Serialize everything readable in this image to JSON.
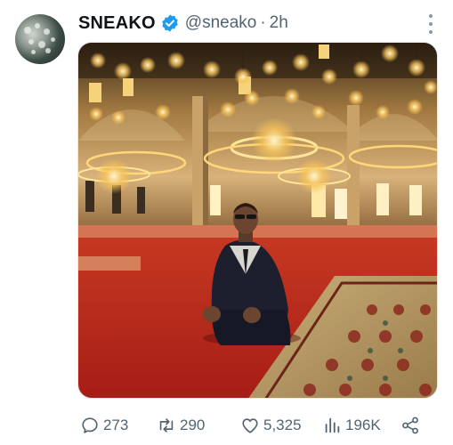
{
  "tweet": {
    "author_name": "SNEAKO",
    "handle": "@sneako",
    "separator": "·",
    "time": "2h",
    "verified": true
  },
  "media": {
    "description_icon": "photo"
  },
  "actions": {
    "replies": "273",
    "retweets": "290",
    "likes": "5,325",
    "views": "196K"
  },
  "colors": {
    "verified_blue": "#1d9bf0",
    "secondary_text": "#536471",
    "carpet_red": "#b3241a",
    "lantern_gold": "#f6c35a"
  },
  "icons": {
    "reply": "reply-icon",
    "retweet": "retweet-icon",
    "like": "heart-icon",
    "views": "views-icon",
    "share": "share-icon",
    "more": "more-icon",
    "verified": "verified-badge-icon"
  }
}
